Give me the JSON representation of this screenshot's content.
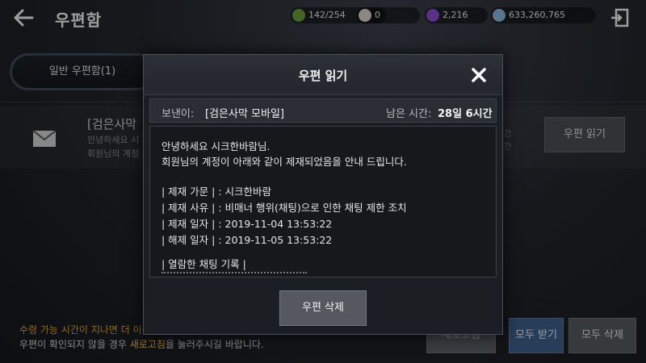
{
  "header": {
    "title": "우편함",
    "back_icon": "back-arrow-icon",
    "exit_icon": "exit-door-icon"
  },
  "currencies": [
    {
      "icon": "energy-icon",
      "value": "142/254",
      "color": "#6a9a3a"
    },
    {
      "icon": "pearl-icon",
      "value": "0",
      "color": "#d8d0cc"
    },
    {
      "icon": "crystal-icon",
      "value": "2,216",
      "color": "#8a4cd0"
    },
    {
      "icon": "silver-icon",
      "value": "633,260,765",
      "color": "#8ab4d8"
    }
  ],
  "tabs": {
    "general": "일반 우편함(1)"
  },
  "mail_item": {
    "sender": "[검은사막",
    "preview_line1": "안녕하세요 시",
    "preview_line2": "회원님의 계정",
    "time_line1": "간",
    "time_line2": "간",
    "read_button": "우편 읽기"
  },
  "footer": {
    "notice_warning": "수령 가능 시간이 지나면 더 이상 물품을 수령할 수 없습니다.",
    "notice_info_prefix": "우편이 확인되지 않을 경우 ",
    "notice_info_link": "새로고침",
    "notice_info_suffix": "을 눌러주시길 바랍니다.",
    "refresh_button": "새로고침",
    "receive_all_button": "모두 받기",
    "delete_all_button": "모두 삭제"
  },
  "modal": {
    "title": "우편 읽기",
    "sender_label": "보낸이:",
    "sender_value": "[검은사막 모바일]",
    "remain_label": "남은 시간:",
    "remain_value": "28일 6시간",
    "body": {
      "greeting": "안녕하세요 시크한바람님.",
      "intro": "회원님의 계정이 아래와 같이 제재되었음을 안내 드립니다.",
      "family": "| 제재 가문 |  : 시크한바람",
      "reason": "| 제재 사유 |  : 비매너 행위(채팅)으로 인한 채팅 제한 조치",
      "start": "| 제재 일자 |  : 2019-11-04 13:53:22",
      "end": "| 해제 일자 |  : 2019-11-05 13:53:22",
      "log_header": "| 열람한 채팅 기록 |"
    },
    "delete_button": "우편 삭제"
  }
}
